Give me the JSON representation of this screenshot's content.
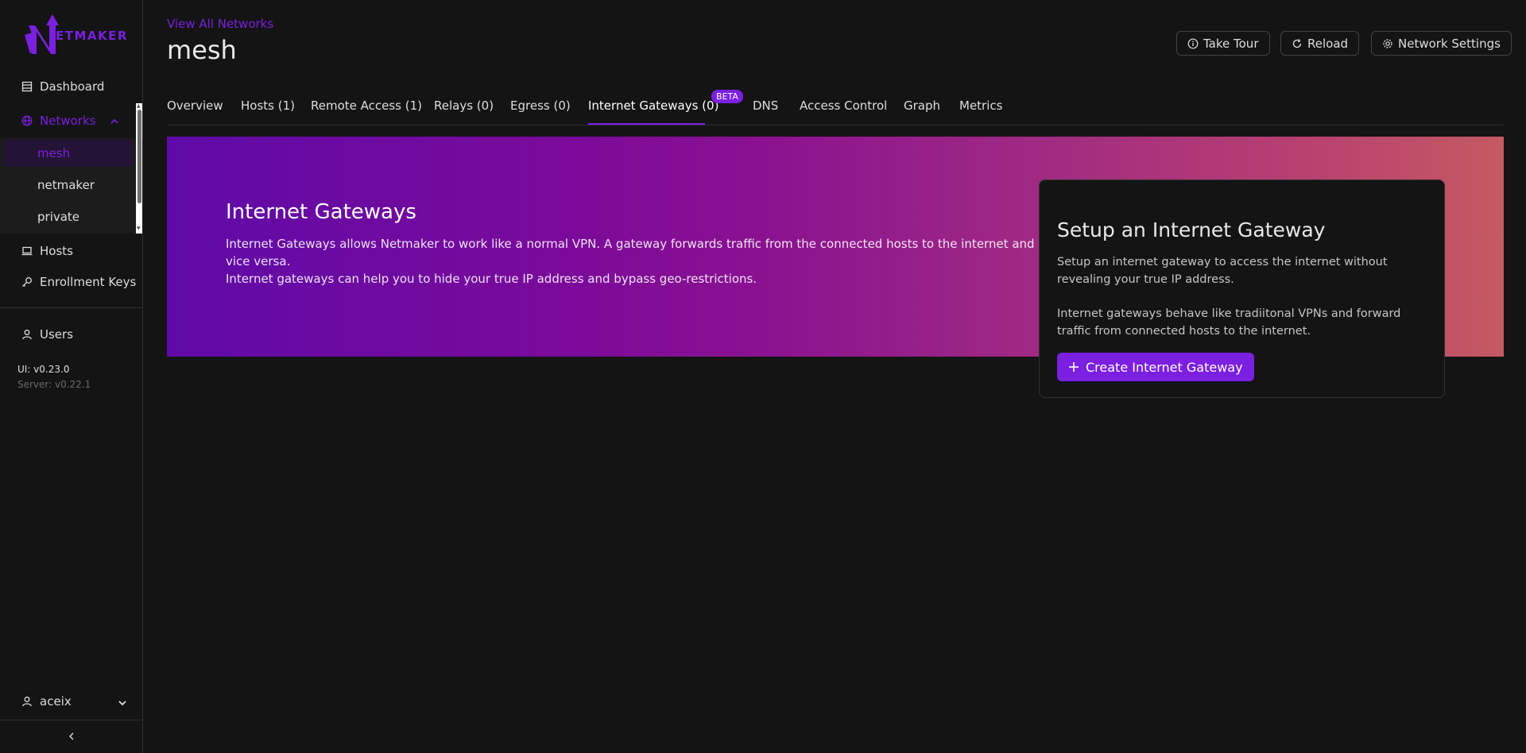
{
  "brand": {
    "logo_text": "ETMAKER",
    "accent": "#7b1fe0"
  },
  "sidebar": {
    "items": [
      {
        "label": "Dashboard",
        "icon": "dashboard-icon"
      },
      {
        "label": "Networks",
        "icon": "globe-icon"
      },
      {
        "label": "Hosts",
        "icon": "laptop-icon"
      },
      {
        "label": "Enrollment Keys",
        "icon": "key-icon"
      },
      {
        "label": "Users",
        "icon": "user-icon"
      }
    ],
    "networks": [
      "mesh",
      "netmaker",
      "private"
    ],
    "version_ui": "UI: v0.23.0",
    "version_server": "Server: v0.22.1",
    "user": "aceix"
  },
  "header": {
    "breadcrumb": "View All Networks",
    "title": "mesh",
    "buttons": {
      "tour": "Take Tour",
      "reload": "Reload",
      "settings": "Network Settings"
    }
  },
  "tabs": [
    "Overview",
    "Hosts (1)",
    "Remote Access (1)",
    "Relays (0)",
    "Egress (0)",
    "Internet Gateways (0)",
    "DNS",
    "Access Control",
    "Graph",
    "Metrics"
  ],
  "active_tab": "Internet Gateways (0)",
  "beta_badge": "BETA",
  "banner": {
    "title": "Internet Gateways",
    "line1": "Internet Gateways allows Netmaker to work like a normal VPN. A gateway forwards traffic from the connected hosts to the internet and vice versa.",
    "line2": "Internet gateways can help you to hide your true IP address and bypass geo-restrictions."
  },
  "card": {
    "title": "Setup an Internet Gateway",
    "p1": "Setup an internet gateway to access the internet without revealing your true IP address.",
    "p2": "Internet gateways behave like tradiitonal VPNs and forward traffic from connected hosts to the internet.",
    "button": "Create Internet Gateway"
  }
}
